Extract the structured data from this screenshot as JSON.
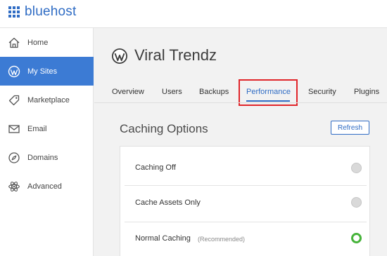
{
  "brand": {
    "name": "bluehost"
  },
  "colors": {
    "brand": "#2f6cc4",
    "active_nav": "#3c7bd4",
    "highlight": "#e0252a",
    "selected_radio": "#46b33a"
  },
  "sidebar": {
    "items": [
      {
        "label": "Home",
        "icon": "home-icon",
        "active": false
      },
      {
        "label": "My Sites",
        "icon": "wordpress-icon",
        "active": true
      },
      {
        "label": "Marketplace",
        "icon": "tag-icon",
        "active": false
      },
      {
        "label": "Email",
        "icon": "envelope-icon",
        "active": false
      },
      {
        "label": "Domains",
        "icon": "compass-icon",
        "active": false
      },
      {
        "label": "Advanced",
        "icon": "atom-icon",
        "active": false
      }
    ]
  },
  "site": {
    "title": "Viral Trendz",
    "icon": "wordpress-icon"
  },
  "tabs": [
    {
      "label": "Overview",
      "active": false
    },
    {
      "label": "Users",
      "active": false
    },
    {
      "label": "Backups",
      "active": false
    },
    {
      "label": "Performance",
      "active": true
    },
    {
      "label": "Security",
      "active": false
    },
    {
      "label": "Plugins",
      "active": false
    }
  ],
  "caching": {
    "title": "Caching Options",
    "refresh_label": "Refresh",
    "options": [
      {
        "label": "Caching Off",
        "note": "",
        "selected": false
      },
      {
        "label": "Cache Assets Only",
        "note": "",
        "selected": false
      },
      {
        "label": "Normal Caching",
        "note": "(Recommended)",
        "selected": true
      }
    ]
  }
}
